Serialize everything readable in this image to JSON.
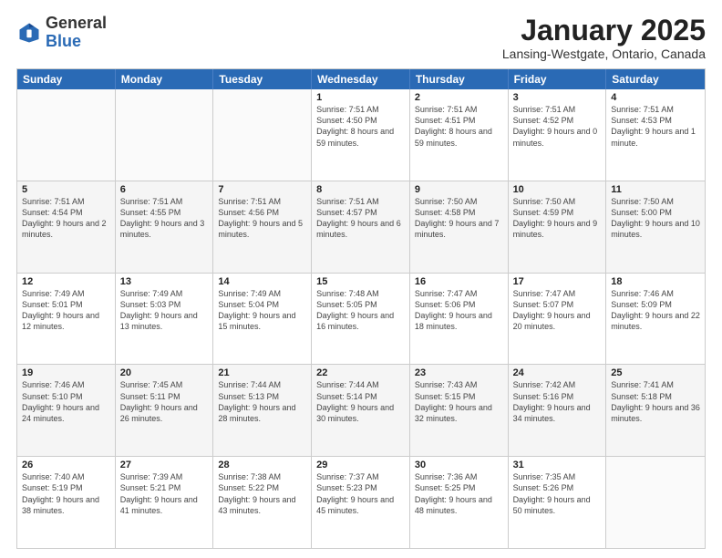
{
  "header": {
    "logo_general": "General",
    "logo_blue": "Blue",
    "month_title": "January 2025",
    "location": "Lansing-Westgate, Ontario, Canada"
  },
  "weekdays": [
    "Sunday",
    "Monday",
    "Tuesday",
    "Wednesday",
    "Thursday",
    "Friday",
    "Saturday"
  ],
  "rows": [
    [
      {
        "day": "",
        "info": ""
      },
      {
        "day": "",
        "info": ""
      },
      {
        "day": "",
        "info": ""
      },
      {
        "day": "1",
        "info": "Sunrise: 7:51 AM\nSunset: 4:50 PM\nDaylight: 8 hours\nand 59 minutes."
      },
      {
        "day": "2",
        "info": "Sunrise: 7:51 AM\nSunset: 4:51 PM\nDaylight: 8 hours\nand 59 minutes."
      },
      {
        "day": "3",
        "info": "Sunrise: 7:51 AM\nSunset: 4:52 PM\nDaylight: 9 hours\nand 0 minutes."
      },
      {
        "day": "4",
        "info": "Sunrise: 7:51 AM\nSunset: 4:53 PM\nDaylight: 9 hours\nand 1 minute."
      }
    ],
    [
      {
        "day": "5",
        "info": "Sunrise: 7:51 AM\nSunset: 4:54 PM\nDaylight: 9 hours\nand 2 minutes."
      },
      {
        "day": "6",
        "info": "Sunrise: 7:51 AM\nSunset: 4:55 PM\nDaylight: 9 hours\nand 3 minutes."
      },
      {
        "day": "7",
        "info": "Sunrise: 7:51 AM\nSunset: 4:56 PM\nDaylight: 9 hours\nand 5 minutes."
      },
      {
        "day": "8",
        "info": "Sunrise: 7:51 AM\nSunset: 4:57 PM\nDaylight: 9 hours\nand 6 minutes."
      },
      {
        "day": "9",
        "info": "Sunrise: 7:50 AM\nSunset: 4:58 PM\nDaylight: 9 hours\nand 7 minutes."
      },
      {
        "day": "10",
        "info": "Sunrise: 7:50 AM\nSunset: 4:59 PM\nDaylight: 9 hours\nand 9 minutes."
      },
      {
        "day": "11",
        "info": "Sunrise: 7:50 AM\nSunset: 5:00 PM\nDaylight: 9 hours\nand 10 minutes."
      }
    ],
    [
      {
        "day": "12",
        "info": "Sunrise: 7:49 AM\nSunset: 5:01 PM\nDaylight: 9 hours\nand 12 minutes."
      },
      {
        "day": "13",
        "info": "Sunrise: 7:49 AM\nSunset: 5:03 PM\nDaylight: 9 hours\nand 13 minutes."
      },
      {
        "day": "14",
        "info": "Sunrise: 7:49 AM\nSunset: 5:04 PM\nDaylight: 9 hours\nand 15 minutes."
      },
      {
        "day": "15",
        "info": "Sunrise: 7:48 AM\nSunset: 5:05 PM\nDaylight: 9 hours\nand 16 minutes."
      },
      {
        "day": "16",
        "info": "Sunrise: 7:47 AM\nSunset: 5:06 PM\nDaylight: 9 hours\nand 18 minutes."
      },
      {
        "day": "17",
        "info": "Sunrise: 7:47 AM\nSunset: 5:07 PM\nDaylight: 9 hours\nand 20 minutes."
      },
      {
        "day": "18",
        "info": "Sunrise: 7:46 AM\nSunset: 5:09 PM\nDaylight: 9 hours\nand 22 minutes."
      }
    ],
    [
      {
        "day": "19",
        "info": "Sunrise: 7:46 AM\nSunset: 5:10 PM\nDaylight: 9 hours\nand 24 minutes."
      },
      {
        "day": "20",
        "info": "Sunrise: 7:45 AM\nSunset: 5:11 PM\nDaylight: 9 hours\nand 26 minutes."
      },
      {
        "day": "21",
        "info": "Sunrise: 7:44 AM\nSunset: 5:13 PM\nDaylight: 9 hours\nand 28 minutes."
      },
      {
        "day": "22",
        "info": "Sunrise: 7:44 AM\nSunset: 5:14 PM\nDaylight: 9 hours\nand 30 minutes."
      },
      {
        "day": "23",
        "info": "Sunrise: 7:43 AM\nSunset: 5:15 PM\nDaylight: 9 hours\nand 32 minutes."
      },
      {
        "day": "24",
        "info": "Sunrise: 7:42 AM\nSunset: 5:16 PM\nDaylight: 9 hours\nand 34 minutes."
      },
      {
        "day": "25",
        "info": "Sunrise: 7:41 AM\nSunset: 5:18 PM\nDaylight: 9 hours\nand 36 minutes."
      }
    ],
    [
      {
        "day": "26",
        "info": "Sunrise: 7:40 AM\nSunset: 5:19 PM\nDaylight: 9 hours\nand 38 minutes."
      },
      {
        "day": "27",
        "info": "Sunrise: 7:39 AM\nSunset: 5:21 PM\nDaylight: 9 hours\nand 41 minutes."
      },
      {
        "day": "28",
        "info": "Sunrise: 7:38 AM\nSunset: 5:22 PM\nDaylight: 9 hours\nand 43 minutes."
      },
      {
        "day": "29",
        "info": "Sunrise: 7:37 AM\nSunset: 5:23 PM\nDaylight: 9 hours\nand 45 minutes."
      },
      {
        "day": "30",
        "info": "Sunrise: 7:36 AM\nSunset: 5:25 PM\nDaylight: 9 hours\nand 48 minutes."
      },
      {
        "day": "31",
        "info": "Sunrise: 7:35 AM\nSunset: 5:26 PM\nDaylight: 9 hours\nand 50 minutes."
      },
      {
        "day": "",
        "info": ""
      }
    ]
  ]
}
